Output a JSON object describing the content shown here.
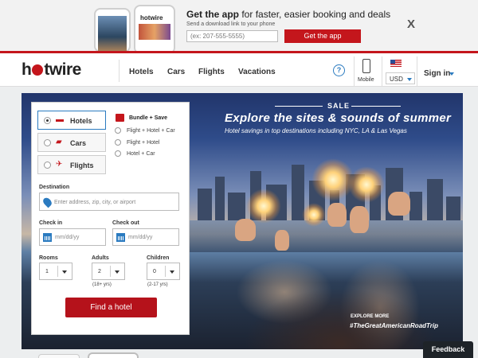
{
  "promo": {
    "title_bold": "Get the app",
    "title_rest": " for faster, easier booking and deals",
    "subtitle": "Send a download link to your phone",
    "phone_placeholder": "(ex: 207-555-5555)",
    "button_label": "Get the app",
    "close_label": "X",
    "mini_logo": "hotwire"
  },
  "header": {
    "logo_h": "h",
    "logo_rest": "twire",
    "nav": [
      "Hotels",
      "Cars",
      "Flights",
      "Vacations"
    ],
    "help_label": "?",
    "mobile_label": "Mobile",
    "currency": "USD",
    "signin_label": "Sign in"
  },
  "hero": {
    "sale_label": "SALE",
    "title": "Explore the sites & sounds of summer",
    "subtitle": "Hotel savings in top destinations including NYC, LA & Las Vegas",
    "explore_more": "EXPLORE MORE",
    "hashtag": "#TheGreatAmericanRoadTrip"
  },
  "search": {
    "options": [
      "Hotels",
      "Cars",
      "Flights"
    ],
    "selected_option": "Hotels",
    "bundle_title": "Bundle + Save",
    "bundle_options": [
      "Flight + Hotel + Car",
      "Flight + Hotel",
      "Hotel + Car"
    ],
    "destination_label": "Destination",
    "destination_placeholder": "Enter address, zip, city, or airport",
    "checkin_label": "Check in",
    "checkout_label": "Check out",
    "date_placeholder": "mm/dd/yy",
    "rooms_label": "Rooms",
    "adults_label": "Adults",
    "children_label": "Children",
    "rooms_value": "1",
    "adults_value": "2",
    "children_value": "0",
    "adults_note": "(18+ yrs)",
    "children_note": "(2-17 yrs)",
    "find_button": "Find a hotel"
  },
  "feedback_label": "Feedback",
  "colors": {
    "brand_red": "#c4161c",
    "link_blue": "#2b7bc0"
  }
}
